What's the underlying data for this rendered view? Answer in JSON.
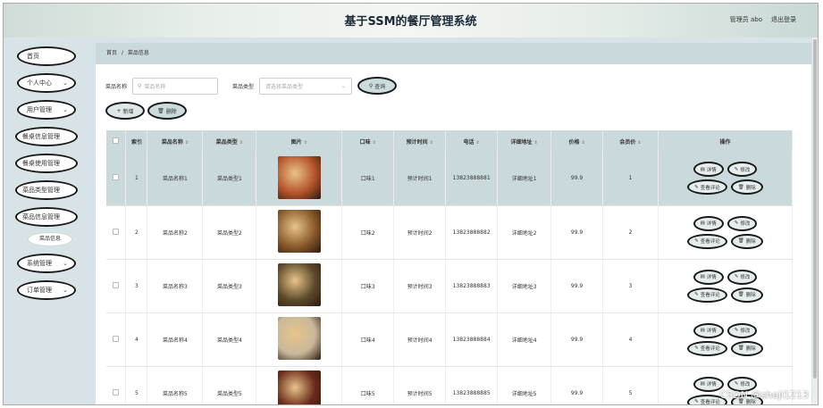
{
  "header": {
    "title": "基于SSM的餐厅管理系统",
    "user": "管理员 abo",
    "logout": "退出登录"
  },
  "sidebar": {
    "items": [
      {
        "label": "首页",
        "chevron": false
      },
      {
        "label": "个人中心",
        "chevron": true
      },
      {
        "label": "用户管理",
        "chevron": true
      },
      {
        "label": "餐桌信息管理",
        "chevron": false
      },
      {
        "label": "餐桌使用管理",
        "chevron": false
      },
      {
        "label": "菜品类型管理",
        "chevron": false
      },
      {
        "label": "菜品信息管理",
        "chevron": false
      }
    ],
    "sub_item": "菜品信息",
    "items2": [
      {
        "label": "系统管理",
        "chevron": true
      },
      {
        "label": "订单管理",
        "chevron": true
      }
    ]
  },
  "breadcrumb": {
    "home": "首页",
    "sep": "/",
    "current": "菜品信息"
  },
  "filters": {
    "name_label": "菜品名称",
    "name_placeholder": "菜品名称",
    "type_label": "菜品类型",
    "type_placeholder": "请选择菜品类型",
    "query": "查询"
  },
  "actions": {
    "add": "新增",
    "delete": "删除"
  },
  "table": {
    "headers": [
      "索引",
      "菜品名称",
      "菜品类型",
      "图片",
      "口味",
      "预计时间",
      "电话",
      "详细地址",
      "价格",
      "会员价",
      "操作"
    ],
    "rows": [
      {
        "idx": "1",
        "name": "菜品名称1",
        "type": "菜品类型1",
        "taste": "口味1",
        "time": "预计时间1",
        "phone": "13823888881",
        "addr": "详细地址1",
        "price": "99.9",
        "vip": "1",
        "img": "#b5532a"
      },
      {
        "idx": "2",
        "name": "菜品名称2",
        "type": "菜品类型2",
        "taste": "口味2",
        "time": "预计时间2",
        "phone": "13823888882",
        "addr": "详细地址2",
        "price": "99.9",
        "vip": "2",
        "img": "#8a5a2b"
      },
      {
        "idx": "3",
        "name": "菜品名称3",
        "type": "菜品类型3",
        "taste": "口味3",
        "time": "预计时间3",
        "phone": "13823888883",
        "addr": "详细地址3",
        "price": "99.9",
        "vip": "3",
        "img": "#5d4a2a"
      },
      {
        "idx": "4",
        "name": "菜品名称4",
        "type": "菜品类型4",
        "taste": "口味4",
        "time": "预计时间4",
        "phone": "13823888884",
        "addr": "详细地址4",
        "price": "99.9",
        "vip": "4",
        "img": "#c9b89a"
      },
      {
        "idx": "5",
        "name": "菜品名称5",
        "type": "菜品类型5",
        "taste": "口味5",
        "time": "预计时间5",
        "phone": "13823888885",
        "addr": "详细地址5",
        "price": "99.9",
        "vip": "5",
        "img": "#6b2a1a"
      }
    ],
    "ops": {
      "detail": "详情",
      "edit": "修改",
      "review": "查看评论",
      "delete": "删除"
    }
  },
  "watermark": "CSDN @sheji1213"
}
